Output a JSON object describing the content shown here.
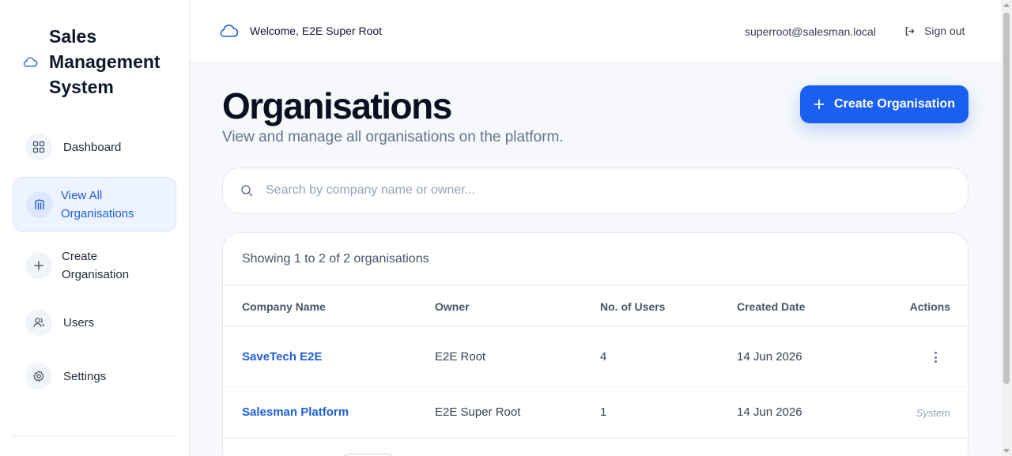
{
  "app": {
    "title": "Sales Management System"
  },
  "sidebar": {
    "items": [
      {
        "label": "Dashboard",
        "icon": "grid-icon"
      },
      {
        "label": "View All Organisations",
        "icon": "building-icon",
        "active": true
      },
      {
        "label": "Create Organisation",
        "icon": "plus-icon"
      },
      {
        "label": "Users",
        "icon": "users-icon"
      },
      {
        "label": "Settings",
        "icon": "gear-icon"
      }
    ]
  },
  "header": {
    "welcome": "Welcome, E2E Super Root",
    "email": "superroot@salesman.local",
    "signout": "Sign out"
  },
  "main": {
    "title": "Organisations",
    "subtitle": "View and manage all organisations on the platform.",
    "create_button": "Create Organisation",
    "search": {
      "placeholder": "Search by company name or owner...",
      "value": ""
    },
    "summary": "Showing 1 to 2 of 2 organisations",
    "table": {
      "columns": [
        "Company Name",
        "Owner",
        "No. of Users",
        "Created Date",
        "Actions"
      ],
      "rows": [
        {
          "company": "SaveTech E2E",
          "owner": "E2E Root",
          "users": "4",
          "created": "14 Jun 2026",
          "action": ""
        },
        {
          "company": "Salesman Platform",
          "owner": "E2E Super Root",
          "users": "1",
          "created": "14 Jun 2026",
          "action": "System"
        }
      ]
    }
  },
  "colors": {
    "accent": "#1a5ff0",
    "link": "#1d5fd6",
    "active_bg": "#eef4ff"
  }
}
